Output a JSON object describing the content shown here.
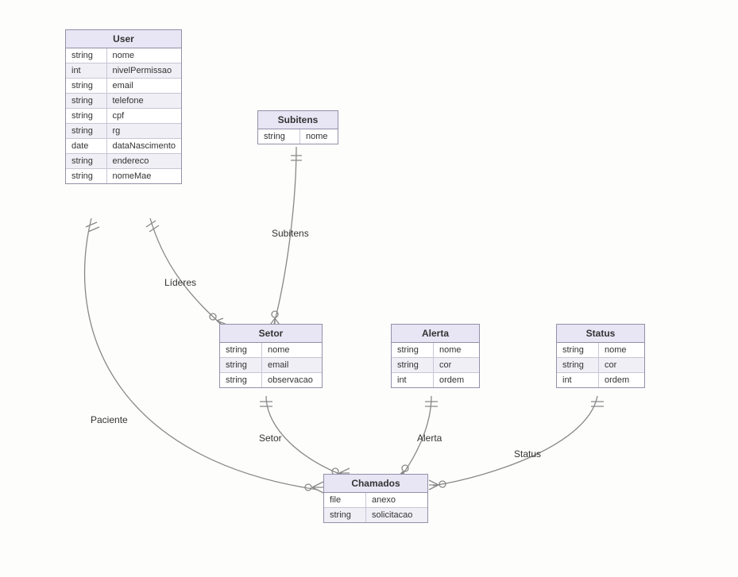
{
  "entities": {
    "user": {
      "title": "User",
      "attrs": [
        {
          "type": "string",
          "name": "nome"
        },
        {
          "type": "int",
          "name": "nivelPermissao"
        },
        {
          "type": "string",
          "name": "email"
        },
        {
          "type": "string",
          "name": "telefone"
        },
        {
          "type": "string",
          "name": "cpf"
        },
        {
          "type": "string",
          "name": "rg"
        },
        {
          "type": "date",
          "name": "dataNascimento"
        },
        {
          "type": "string",
          "name": "endereco"
        },
        {
          "type": "string",
          "name": "nomeMae"
        }
      ]
    },
    "subitens": {
      "title": "Subitens",
      "attrs": [
        {
          "type": "string",
          "name": "nome"
        }
      ]
    },
    "setor": {
      "title": "Setor",
      "attrs": [
        {
          "type": "string",
          "name": "nome"
        },
        {
          "type": "string",
          "name": "email"
        },
        {
          "type": "string",
          "name": "observacao"
        }
      ]
    },
    "alerta": {
      "title": "Alerta",
      "attrs": [
        {
          "type": "string",
          "name": "nome"
        },
        {
          "type": "string",
          "name": "cor"
        },
        {
          "type": "int",
          "name": "ordem"
        }
      ]
    },
    "status": {
      "title": "Status",
      "attrs": [
        {
          "type": "string",
          "name": "nome"
        },
        {
          "type": "string",
          "name": "cor"
        },
        {
          "type": "int",
          "name": "ordem"
        }
      ]
    },
    "chamados": {
      "title": "Chamados",
      "attrs": [
        {
          "type": "file",
          "name": "anexo"
        },
        {
          "type": "string",
          "name": "solicitacao"
        }
      ]
    }
  },
  "relationships": {
    "lideres": {
      "label": "Líderes",
      "from": "user",
      "to": "setor",
      "from_card": "one",
      "to_card": "many"
    },
    "subitens": {
      "label": "Subitens",
      "from": "subitens",
      "to": "setor",
      "from_card": "one",
      "to_card": "many"
    },
    "paciente": {
      "label": "Paciente",
      "from": "user",
      "to": "chamados",
      "from_card": "one",
      "to_card": "many"
    },
    "setor": {
      "label": "Setor",
      "from": "setor",
      "to": "chamados",
      "from_card": "one",
      "to_card": "many"
    },
    "alerta": {
      "label": "Alerta",
      "from": "alerta",
      "to": "chamados",
      "from_card": "one",
      "to_card": "many"
    },
    "status": {
      "label": "Status",
      "from": "status",
      "to": "chamados",
      "from_card": "one",
      "to_card": "many"
    }
  },
  "chart_data": {
    "type": "er-diagram",
    "entities": [
      {
        "name": "User",
        "attributes": [
          [
            "string",
            "nome"
          ],
          [
            "int",
            "nivelPermissao"
          ],
          [
            "string",
            "email"
          ],
          [
            "string",
            "telefone"
          ],
          [
            "string",
            "cpf"
          ],
          [
            "string",
            "rg"
          ],
          [
            "date",
            "dataNascimento"
          ],
          [
            "string",
            "endereco"
          ],
          [
            "string",
            "nomeMae"
          ]
        ]
      },
      {
        "name": "Subitens",
        "attributes": [
          [
            "string",
            "nome"
          ]
        ]
      },
      {
        "name": "Setor",
        "attributes": [
          [
            "string",
            "nome"
          ],
          [
            "string",
            "email"
          ],
          [
            "string",
            "observacao"
          ]
        ]
      },
      {
        "name": "Alerta",
        "attributes": [
          [
            "string",
            "nome"
          ],
          [
            "string",
            "cor"
          ],
          [
            "int",
            "ordem"
          ]
        ]
      },
      {
        "name": "Status",
        "attributes": [
          [
            "string",
            "nome"
          ],
          [
            "string",
            "cor"
          ],
          [
            "int",
            "ordem"
          ]
        ]
      },
      {
        "name": "Chamados",
        "attributes": [
          [
            "file",
            "anexo"
          ],
          [
            "string",
            "solicitacao"
          ]
        ]
      }
    ],
    "relationships": [
      {
        "left": "User",
        "label": "Líderes",
        "right": "Setor",
        "left_card": "exactly-one",
        "right_card": "zero-or-many"
      },
      {
        "left": "Subitens",
        "label": "Subitens",
        "right": "Setor",
        "left_card": "exactly-one",
        "right_card": "zero-or-many"
      },
      {
        "left": "User",
        "label": "Paciente",
        "right": "Chamados",
        "left_card": "exactly-one",
        "right_card": "zero-or-many"
      },
      {
        "left": "Setor",
        "label": "Setor",
        "right": "Chamados",
        "left_card": "exactly-one",
        "right_card": "zero-or-many"
      },
      {
        "left": "Alerta",
        "label": "Alerta",
        "right": "Chamados",
        "left_card": "exactly-one",
        "right_card": "zero-or-many"
      },
      {
        "left": "Status",
        "label": "Status",
        "right": "Chamados",
        "left_card": "exactly-one",
        "right_card": "zero-or-many"
      }
    ]
  }
}
